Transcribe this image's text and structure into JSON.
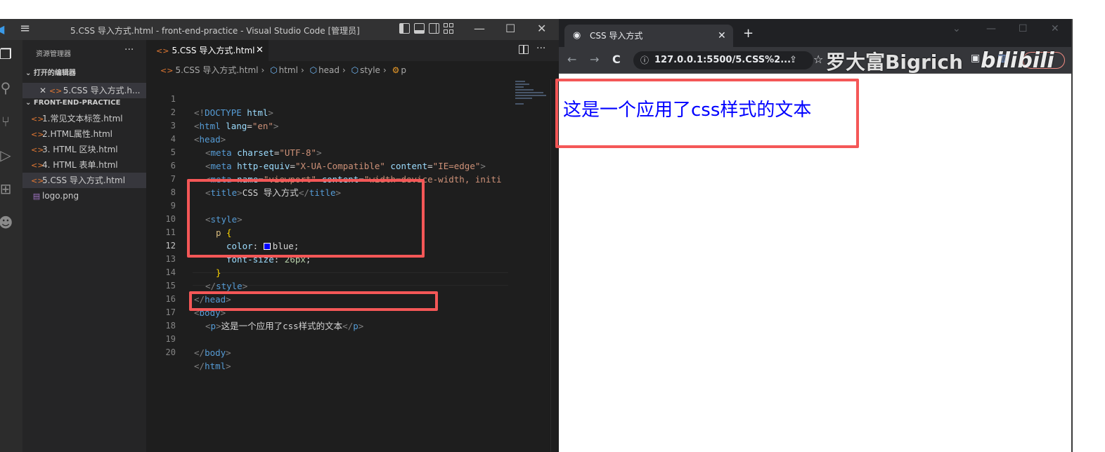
{
  "vscode": {
    "title": "5.CSS 导入方式.html - front-end-practice - Visual Studio Code [管理员]",
    "sidebar": {
      "header": "资源管理器",
      "open_editors_label": "打开的编辑器",
      "open_editor_file": "5.CSS 导入方式.h...",
      "project_label": "FRONT-END-PRACTICE",
      "files": [
        "1.常见文本标签.html",
        "2.HTML属性.html",
        "3. HTML 区块.html",
        "4. HTML 表单.html",
        "5.CSS 导入方式.html",
        "logo.png"
      ]
    },
    "tab": {
      "label": "5.CSS 导入方式.html"
    },
    "breadcrumb": [
      "5.CSS 导入方式.html",
      "html",
      "head",
      "style",
      "p"
    ],
    "code": {
      "line_numbers": [
        "1",
        "2",
        "3",
        "4",
        "5",
        "6",
        "7",
        "8",
        "9",
        "10",
        "11",
        "12",
        "13",
        "14",
        "15",
        "16",
        "17",
        "18",
        "19",
        "20"
      ],
      "l1": [
        "<!",
        "DOCTYPE",
        " html",
        ">"
      ],
      "l2": [
        "<",
        "html",
        " lang",
        "=",
        "\"en\"",
        ">"
      ],
      "l3": [
        "<",
        "head",
        ">"
      ],
      "l4": [
        "<",
        "meta",
        " charset",
        "=",
        "\"UTF-8\"",
        ">"
      ],
      "l5": [
        "<",
        "meta",
        " http-equiv",
        "=",
        "\"X-UA-Compatible\"",
        " content",
        "=",
        "\"IE=edge\"",
        ">"
      ],
      "l6": [
        "<",
        "meta",
        " name",
        "=",
        "\"viewport\"",
        " content",
        "=",
        "\"width=device-width, initi"
      ],
      "l7": [
        "<",
        "title",
        ">",
        "CSS 导入方式",
        "</",
        "title",
        ">"
      ],
      "l9": [
        "<",
        "style",
        ">"
      ],
      "l10": [
        "p",
        " {"
      ],
      "l11": [
        "color",
        ": ",
        "blue",
        ";"
      ],
      "l12": [
        "font-size",
        ": ",
        "26px",
        ";"
      ],
      "l13": [
        "}"
      ],
      "l14": [
        "</",
        "style",
        ">"
      ],
      "l15": [
        "</",
        "head",
        ">"
      ],
      "l16": [
        "<",
        "body",
        ">"
      ],
      "l17": [
        "<",
        "p",
        ">",
        "这是一个应用了css样式的文本",
        "</",
        "p",
        ">"
      ],
      "l19": [
        "</",
        "body",
        ">"
      ],
      "l20": [
        "</",
        "html",
        ">"
      ]
    }
  },
  "browser": {
    "tab_title": "CSS 导入方式",
    "url": "127.0.0.1:5500/5.CSS%2...",
    "page_text": "这是一个应用了css样式的文本",
    "watermark_name": "罗大富Bigrich",
    "watermark_logo": "bilibili"
  },
  "colors": {
    "highlight": "#f45757",
    "rendered_text": "#0000ff"
  }
}
